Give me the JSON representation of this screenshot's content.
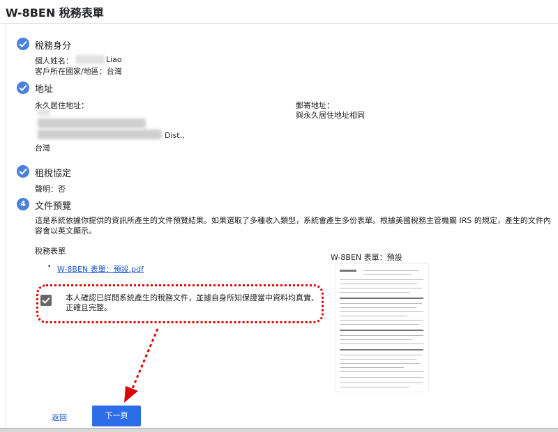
{
  "header": {
    "title": "W-8BEN 稅務表單"
  },
  "steps": {
    "tax_identity": {
      "title": "稅務身分",
      "name_label": "個人姓名：",
      "name_suffix": "Liao",
      "country_label": "客戶所在國家/地區：台灣"
    },
    "address": {
      "title": "地址",
      "permanent_label": "永久居住地址：",
      "permanent_line3_suffix": "Dist.,",
      "permanent_country": "台灣",
      "mailing_label": "郵寄地址：",
      "mailing_value": "與永久居住地址相同"
    },
    "treaty": {
      "title": "租稅協定",
      "statement": "聲明：否"
    },
    "preview": {
      "number": "4",
      "title": "文件預覽",
      "desc_line1": "這是系統依據你提供的資訊所產生的文件預覽結果。如果選取了多種收入類型，系統會產生多份表單。根據美國稅務主管機關 IRS 的規定，產生的文件內",
      "desc_line2": "容會以英文顯示。",
      "forms_label": "稅務表單",
      "form_link": "W-8BEN 表單：預設.pdf",
      "thumb_label": "W-8BEN 表單：預設",
      "confirm_line1": "本人確認已詳閱系統產生的稅務文件，並據自身所知保證當中資料均真實、",
      "confirm_line2": "正確且完整。",
      "confirm_checked": true
    }
  },
  "footer": {
    "back_label": "返回",
    "next_label": "下一頁"
  },
  "colors": {
    "accent": "#4a80e0",
    "button": "#2d6ee8",
    "link": "#1a56d6",
    "annotation": "#e00000"
  }
}
